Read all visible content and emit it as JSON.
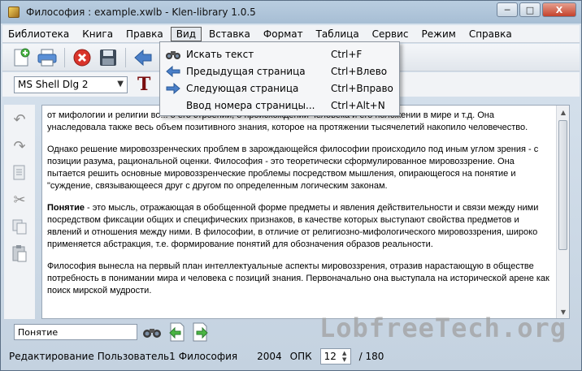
{
  "window": {
    "title": "Философия : example.xwlb - Klen-library 1.0.5",
    "minimize_glyph": "─",
    "maximize_glyph": "□",
    "close_glyph": "X"
  },
  "menu": {
    "items": [
      "Библиотека",
      "Книга",
      "Правка",
      "Вид",
      "Вставка",
      "Формат",
      "Таблица",
      "Сервис",
      "Режим",
      "Справка"
    ],
    "active_index": 3
  },
  "view_menu": {
    "items": [
      {
        "label": "Искать текст",
        "shortcut": "Ctrl+F",
        "icon": "binoculars-icon"
      },
      {
        "label": "Предыдущая страница",
        "shortcut": "Ctrl+Влево",
        "icon": "arrow-left-icon"
      },
      {
        "label": "Следующая страница",
        "shortcut": "Ctrl+Вправо",
        "icon": "arrow-right-icon"
      },
      {
        "label": "Ввод номера страницы...",
        "shortcut": "Ctrl+Alt+N",
        "icon": ""
      }
    ]
  },
  "toolbar": {
    "icons": [
      "new-document-icon",
      "print-icon",
      "delete-icon",
      "save-icon",
      "back-icon"
    ]
  },
  "format": {
    "font_name": "MS Shell Dlg 2",
    "font_arrow": "▼",
    "text_color_glyph": "T"
  },
  "side_toolbar": {
    "icons": [
      "undo-icon",
      "redo-icon",
      "edit-icon",
      "cut-icon",
      "copy-icon",
      "paste-icon"
    ]
  },
  "content": {
    "para1": "от мифологии и религии во... о его строении, о происхождении человека и его положении в мире и т.д. Она унаследовала также весь объем позитивного знания, которое на протяжении тысячелетий накопило человечество.",
    "para2": "Однако решение мировоззренческих проблем в зарождающейся философии происходило под иным углом зрения - с позиции разума, рациональной оценки. Философия - это теоретически сформулированное мировоззрение. Она пытается решить основные мировоззренческие проблемы посредством мышления, опирающегося на понятие и \"суждение, связывающееся друг с другом по определенным логическим законам.",
    "para3_bold": "Понятие",
    "para3_rest": " - это мысль, отражающая в обобщенной форме предметы и явления действительности и связи между ними посредством фиксации общих и специфических признаков, в качестве которых выступают свойства предметов и явлений и отношения между ними. В философии, в отличие от религиозно-мифологического мировоззрения, широко применяется абстракция, т.е. формирование понятий для обозначения образов реальности.",
    "para4": "Философия вынесла на первый план интеллектуальные аспекты мировоззрения, отразив нарастающую в обществе потребность в понимании мира и человека с позиций знания. Первоначально она выступала на исторической арене как поиск мирской мудрости."
  },
  "search": {
    "value": "Понятие"
  },
  "watermark": "LobfreeTech.org",
  "status": {
    "mode": "Редактирование",
    "user": "Пользователь1",
    "book": "Философия",
    "year": "2004",
    "opk_label": "ОПК",
    "page": "12",
    "total": "/ 180"
  }
}
